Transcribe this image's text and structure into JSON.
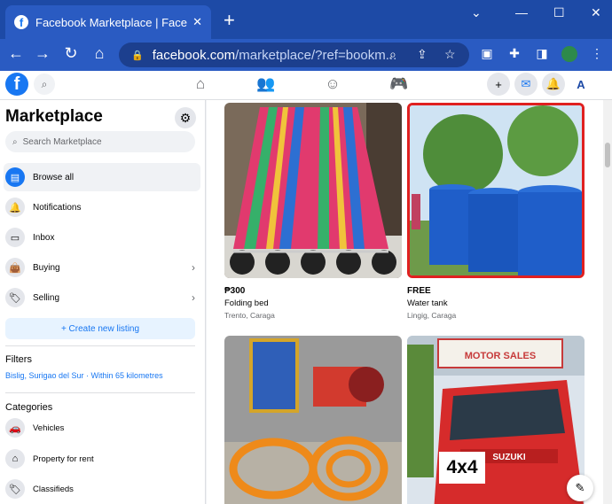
{
  "browser": {
    "tab_title": "Facebook Marketplace | Facebook",
    "tab_close": "✕",
    "new_tab": "+",
    "url_host": "facebook.com",
    "url_path": "/marketplace/?ref=bookm..."
  },
  "sidebar": {
    "title": "Marketplace",
    "search_placeholder": "Search Marketplace",
    "nav": [
      {
        "label": "Browse all",
        "icon": "storefront-icon"
      },
      {
        "label": "Notifications",
        "icon": "bell-icon"
      },
      {
        "label": "Inbox",
        "icon": "inbox-icon"
      },
      {
        "label": "Buying",
        "icon": "bag-icon"
      },
      {
        "label": "Selling",
        "icon": "tag-icon"
      }
    ],
    "create_listing": "+ Create new listing",
    "filters_title": "Filters",
    "filter_text": "Bislig, Surigao del Sur · Within 65 kilometres",
    "categories_title": "Categories",
    "categories": [
      {
        "label": "Vehicles",
        "icon": "car-icon"
      },
      {
        "label": "Property for rent",
        "icon": "house-icon"
      },
      {
        "label": "Classifieds",
        "icon": "tag-icon"
      }
    ]
  },
  "listings": [
    {
      "price": "₱300",
      "title": "Folding bed",
      "location": "Trento, Caraga"
    },
    {
      "price": "FREE",
      "title": "Water tank",
      "location": "Lingig, Caraga"
    },
    {
      "price": "",
      "title": "",
      "location": ""
    },
    {
      "price": "",
      "title": "",
      "location": "",
      "overlay": "4x4",
      "sign": "MOTOR SALES",
      "logo": "SUZUKI"
    }
  ],
  "colors": {
    "accent": "#1877f2",
    "chrome": "#1d4aa6",
    "highlight": "#e02020"
  }
}
